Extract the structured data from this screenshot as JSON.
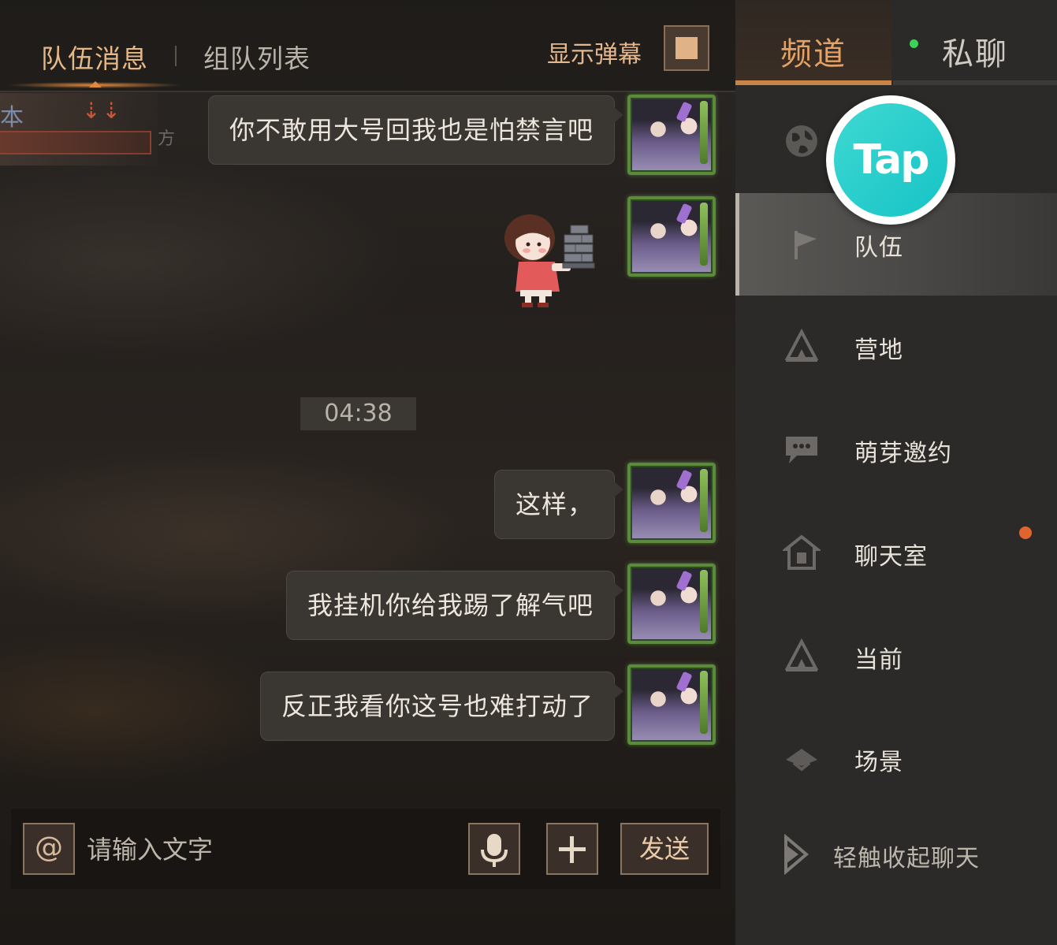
{
  "chat": {
    "tabs": {
      "team_messages": "队伍消息",
      "team_list": "组队列表"
    },
    "danmaku_label": "显示弹幕",
    "messages": [
      {
        "type": "text",
        "text": "你不敢用大号回我也是怕禁言吧"
      },
      {
        "type": "sticker",
        "sticker": "girl-carrying-bricks"
      },
      {
        "type": "text",
        "text": "这样，"
      },
      {
        "type": "text",
        "text": "我挂机你给我踢了解气吧"
      },
      {
        "type": "text",
        "text": "反正我看你这号也难打动了"
      }
    ],
    "timestamp": "04:38",
    "input": {
      "at_symbol": "@",
      "placeholder": "请输入文字",
      "send_label": "发送"
    }
  },
  "sidebar": {
    "tabs": {
      "channel": "频道",
      "private": "私聊"
    },
    "items": [
      {
        "label": "",
        "icon": "globe-icon"
      },
      {
        "label": "队伍",
        "icon": "flag-icon",
        "selected": true
      },
      {
        "label": "营地",
        "icon": "camp-icon"
      },
      {
        "label": "萌芽邀约",
        "icon": "chat-bubble-icon"
      },
      {
        "label": "聊天室",
        "icon": "house-icon",
        "unread": true
      },
      {
        "label": "当前",
        "icon": "camp-icon"
      },
      {
        "label": "场景",
        "icon": "scene-icon"
      }
    ],
    "collapse_label": "轻触收起聊天"
  },
  "overlay": {
    "logo_text": "Tap"
  },
  "colors": {
    "accent": "#e5a264",
    "online": "#3ed15a",
    "unread": "#e0642e"
  }
}
